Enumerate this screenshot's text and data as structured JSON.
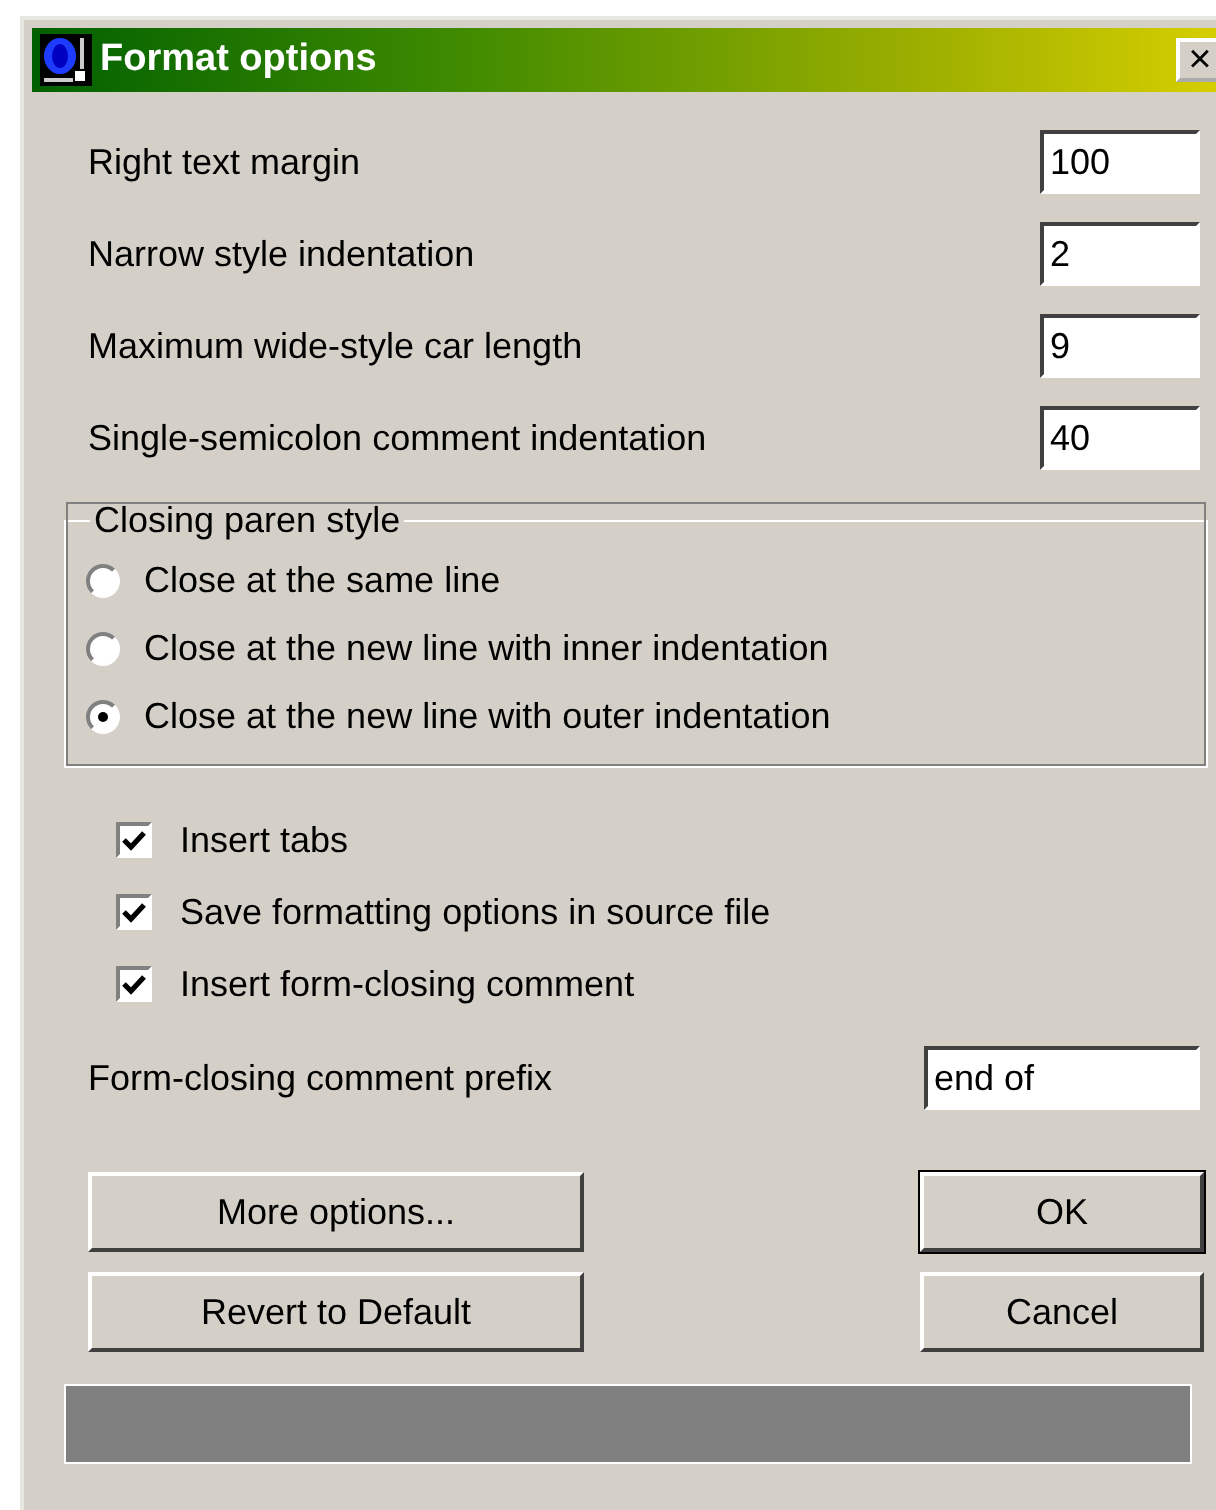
{
  "window": {
    "title": "Format options",
    "close": "×"
  },
  "fields": [
    {
      "label": "Right text margin",
      "value": "100"
    },
    {
      "label": "Narrow style indentation",
      "value": "2"
    },
    {
      "label": "Maximum wide-style car length",
      "value": "9"
    },
    {
      "label": "Single-semicolon comment indentation",
      "value": "40"
    }
  ],
  "closing_paren_style": {
    "title": "Closing paren style",
    "options": [
      {
        "label": "Close at the same line",
        "selected": false
      },
      {
        "label": "Close at the new line with inner indentation",
        "selected": false
      },
      {
        "label": "Close at the new line with outer indentation",
        "selected": true
      }
    ]
  },
  "checkboxes": [
    {
      "label": "Insert tabs",
      "checked": true
    },
    {
      "label": "Save formatting options in source file",
      "checked": true
    },
    {
      "label": "Insert form-closing comment",
      "checked": true
    }
  ],
  "prefix": {
    "label": "Form-closing comment prefix",
    "value": "end of"
  },
  "buttons_left": [
    "More options...",
    "Revert to Default"
  ],
  "buttons_right": [
    {
      "label": "OK",
      "default": true
    },
    {
      "label": "Cancel",
      "default": false
    }
  ]
}
